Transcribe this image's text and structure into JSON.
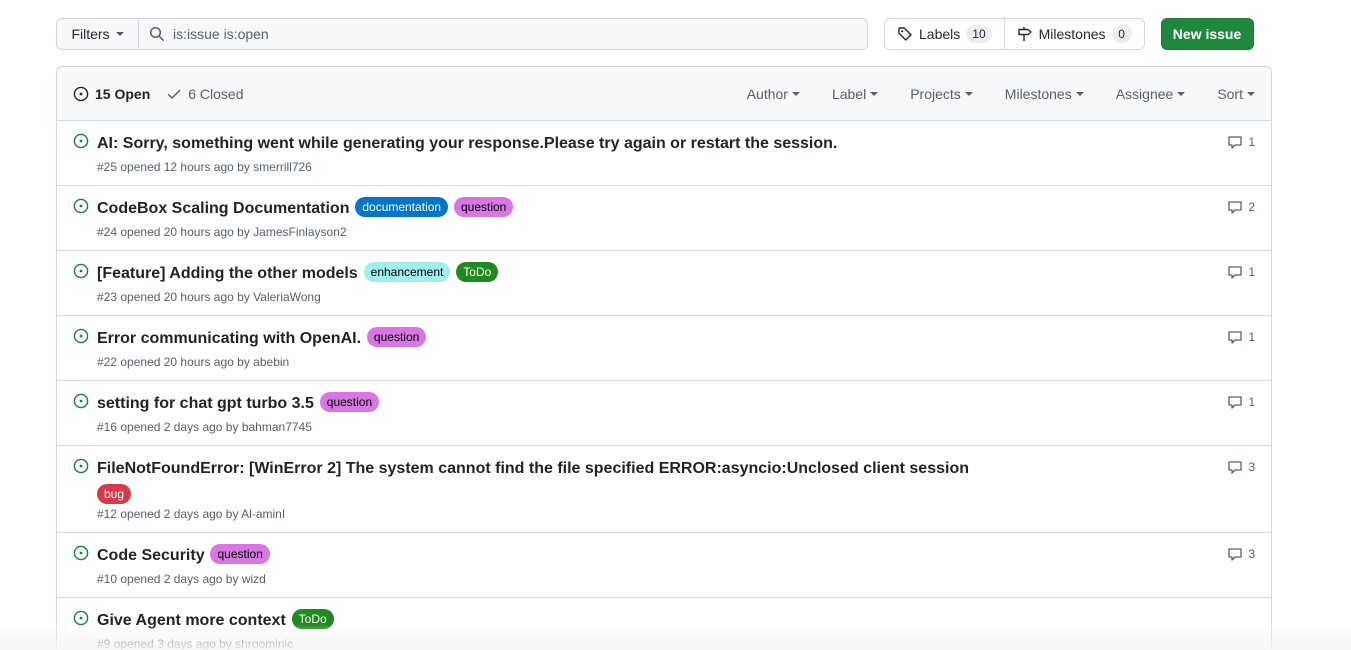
{
  "toolbar": {
    "filters_label": "Filters",
    "search_value": "is:issue is:open",
    "labels_label": "Labels",
    "labels_count": "10",
    "milestones_label": "Milestones",
    "milestones_count": "0",
    "new_issue_label": "New issue",
    "new_issue_color": "#1f883d"
  },
  "header": {
    "open_label": "15 Open",
    "closed_label": "6 Closed",
    "menus": [
      "Author",
      "Label",
      "Projects",
      "Milestones",
      "Assignee",
      "Sort"
    ]
  },
  "issues": [
    {
      "title": "AI: Sorry, something went while generating your response.Please try again or restart the session.",
      "number": "#25",
      "opened": "opened 12 hours ago by",
      "author": "smerrill726",
      "comments": "1",
      "labels": []
    },
    {
      "title": "CodeBox Scaling Documentation",
      "number": "#24",
      "opened": "opened 20 hours ago by",
      "author": "JamesFinlayson2",
      "comments": "2",
      "labels": [
        {
          "name": "documentation",
          "bg": "#0075ca",
          "fg": "#ffffff"
        },
        {
          "name": "question",
          "bg": "#d876e3",
          "fg": "#000000"
        }
      ]
    },
    {
      "title": "[Feature] Adding the other models",
      "number": "#23",
      "opened": "opened 20 hours ago by",
      "author": "ValeriaWong",
      "comments": "1",
      "labels": [
        {
          "name": "enhancement",
          "bg": "#a2eeef",
          "fg": "#000000"
        },
        {
          "name": "ToDo",
          "bg": "#1f8a1f",
          "fg": "#ffffff"
        }
      ]
    },
    {
      "title": "Error communicating with OpenAI.",
      "number": "#22",
      "opened": "opened 20 hours ago by",
      "author": "abebin",
      "comments": "1",
      "labels": [
        {
          "name": "question",
          "bg": "#d876e3",
          "fg": "#000000"
        }
      ]
    },
    {
      "title": "setting for chat gpt turbo 3.5",
      "number": "#16",
      "opened": "opened 2 days ago by",
      "author": "bahman7745",
      "comments": "1",
      "labels": [
        {
          "name": "question",
          "bg": "#d876e3",
          "fg": "#000000"
        }
      ]
    },
    {
      "title": "FileNotFoundError: [WinError 2] The system cannot find the file specified ERROR:asyncio:Unclosed client session",
      "number": "#12",
      "opened": "opened 2 days ago by",
      "author": "Al-aminI",
      "comments": "3",
      "labels": [
        {
          "name": "bug",
          "bg": "#d73a4a",
          "fg": "#ffffff"
        }
      ]
    },
    {
      "title": "Code Security",
      "number": "#10",
      "opened": "opened 2 days ago by",
      "author": "wizd",
      "comments": "3",
      "labels": [
        {
          "name": "question",
          "bg": "#d876e3",
          "fg": "#000000"
        }
      ]
    },
    {
      "title": "Give Agent more context",
      "number": "#9",
      "opened": "opened 3 days ago by",
      "author": "shroominic",
      "comments": "",
      "labels": [
        {
          "name": "ToDo",
          "bg": "#1f8a1f",
          "fg": "#ffffff"
        }
      ]
    }
  ],
  "colors": {
    "open_icon": "#1a7f37",
    "muted": "#57606a",
    "border": "#d0d7de"
  }
}
